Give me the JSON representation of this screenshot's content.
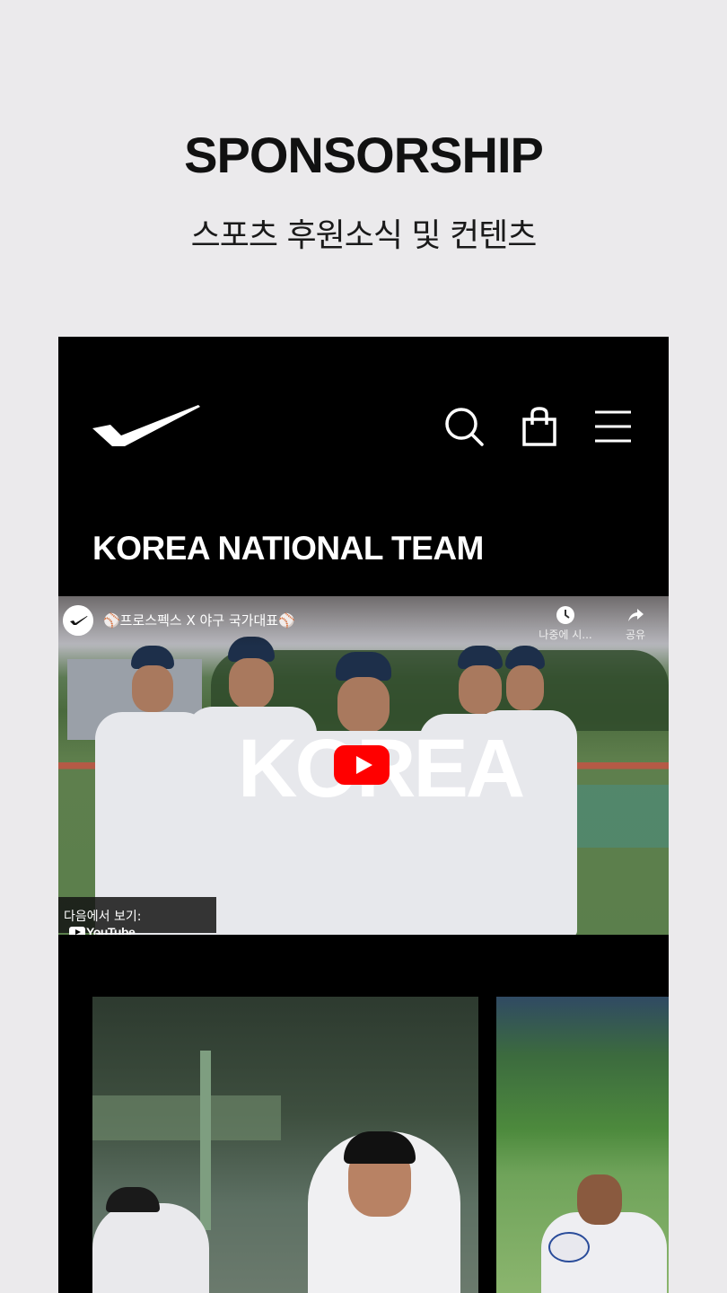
{
  "header": {
    "title": "SPONSORSHIP",
    "subtitle": "스포츠 후원소식 및 컨텐츠"
  },
  "app": {
    "logo_icon": "prospecs-wing-logo-icon",
    "nav_icons": [
      "search-icon",
      "shopping-bag-icon",
      "menu-icon"
    ],
    "section_title": "KOREA NATIONAL TEAM"
  },
  "video": {
    "title": "⚾프로스펙스 X 야구 국가대표⚾",
    "overlay_text": "KOREA",
    "watch_later_label": "나중에 시...",
    "share_label": "공유",
    "watch_on_label": "다음에서 보기:",
    "youtube_label": "YouTube",
    "play_button_color": "#ff0000"
  },
  "colors": {
    "page_background": "#ebeaec",
    "app_background": "#000000",
    "title_color": "#111111"
  }
}
